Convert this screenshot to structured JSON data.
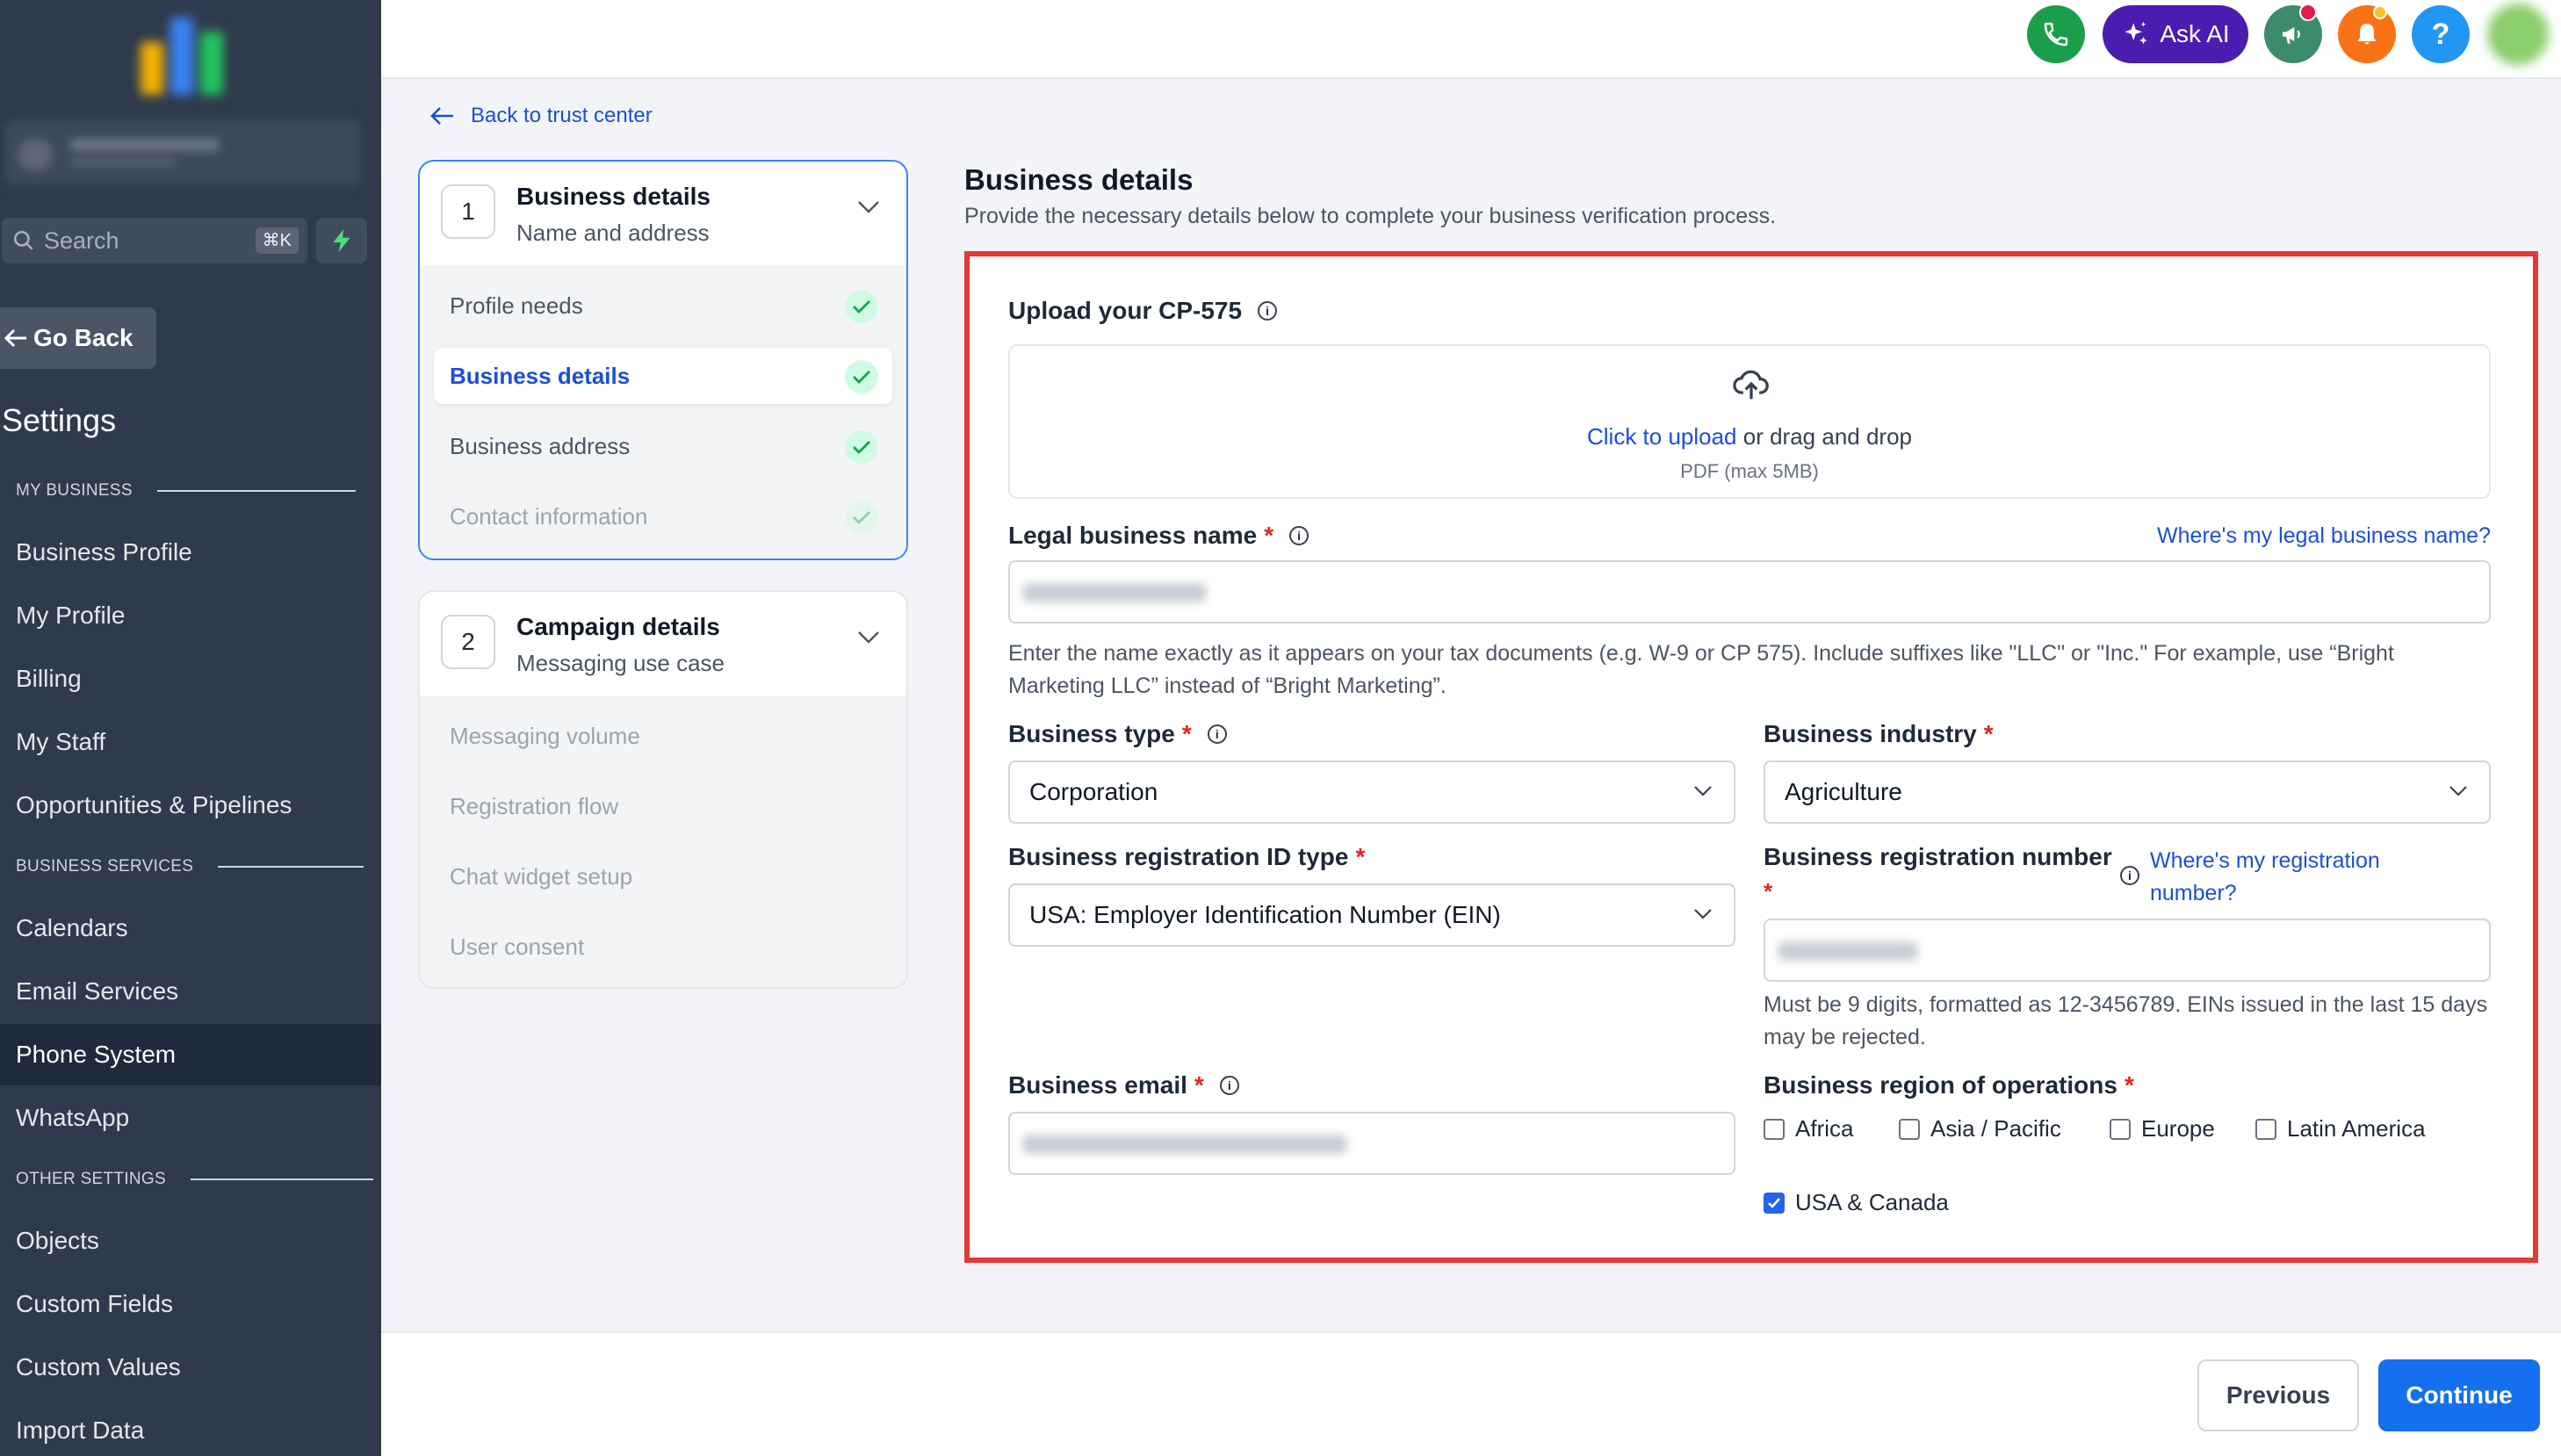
{
  "sidebar": {
    "search_placeholder": "Search",
    "search_shortcut": "⌘K",
    "go_back": "Go Back",
    "title": "Settings",
    "sections": {
      "my_business": "MY BUSINESS",
      "business_services": "BUSINESS SERVICES",
      "other_settings": "OTHER SETTINGS"
    },
    "items": [
      "Business Profile",
      "My Profile",
      "Billing",
      "My Staff",
      "Opportunities & Pipelines",
      "Calendars",
      "Email Services",
      "Phone System",
      "WhatsApp",
      "Objects",
      "Custom Fields",
      "Custom Values",
      "Import Data"
    ],
    "active_item": "Phone System"
  },
  "topbar": {
    "ask_ai": "Ask AI",
    "help_glyph": "?",
    "icons": [
      "phone-icon",
      "sparkle-icon",
      "megaphone-icon",
      "bell-icon",
      "help-icon"
    ],
    "colors": {
      "phone": "#1a9e4b",
      "ask_ai": "#4b1cb0",
      "megaphone": "#3d8b6d",
      "bell": "#f97316",
      "help": "#2196f3"
    }
  },
  "back_link": "Back to trust center",
  "steps": [
    {
      "number": "1",
      "title": "Business details",
      "subtitle": "Name and address",
      "substeps": [
        {
          "label": "Profile needs",
          "done": true
        },
        {
          "label": "Business details",
          "done": true,
          "active": true
        },
        {
          "label": "Business address",
          "done": true
        },
        {
          "label": "Contact information",
          "done": true
        }
      ]
    },
    {
      "number": "2",
      "title": "Campaign details",
      "subtitle": "Messaging use case",
      "substeps": [
        {
          "label": "Messaging volume"
        },
        {
          "label": "Registration flow"
        },
        {
          "label": "Chat widget setup"
        },
        {
          "label": "User consent"
        }
      ]
    }
  ],
  "form": {
    "title": "Business details",
    "subtitle": "Provide the necessary details below to complete your business verification process.",
    "upload": {
      "label": "Upload your CP-575",
      "click": "Click to upload",
      "drag": " or drag and drop",
      "hint": "PDF (max 5MB)"
    },
    "legal_name": {
      "label": "Legal business name",
      "help_link": "Where's my legal business name?",
      "help": "Enter the name exactly as it appears on your tax documents (e.g. W-9 or CP 575). Include suffixes like \"LLC\" or \"Inc.\" For example, use “Bright Marketing LLC” instead of “Bright Marketing”."
    },
    "business_type": {
      "label": "Business type",
      "value": "Corporation"
    },
    "business_industry": {
      "label": "Business industry",
      "value": "Agriculture"
    },
    "reg_id_type": {
      "label": "Business registration ID type",
      "value": "USA: Employer Identification Number (EIN)"
    },
    "reg_number": {
      "label": "Business registration number",
      "help_link": "Where's my registration number?",
      "help": "Must be 9 digits, formatted as 12-3456789. EINs issued in the last 15 days may be rejected."
    },
    "email": {
      "label": "Business email"
    },
    "regions": {
      "label": "Business region of operations",
      "options": [
        {
          "label": "Africa",
          "checked": false
        },
        {
          "label": "Asia / Pacific",
          "checked": false
        },
        {
          "label": "Europe",
          "checked": false
        },
        {
          "label": "Latin America",
          "checked": false
        },
        {
          "label": "USA & Canada",
          "checked": true
        }
      ]
    },
    "required_mark": "*"
  },
  "footer": {
    "previous": "Previous",
    "continue": "Continue"
  }
}
